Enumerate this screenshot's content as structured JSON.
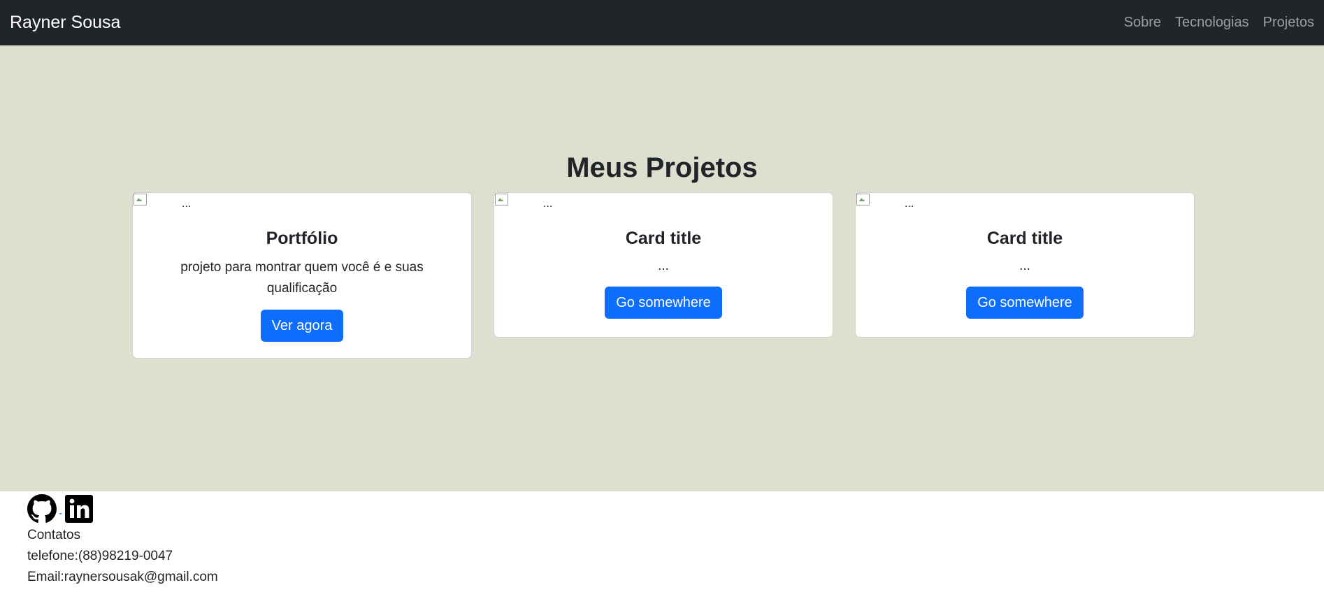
{
  "navbar": {
    "brand": "Rayner Sousa",
    "links": [
      "Sobre",
      "Tecnologias",
      "Projetos"
    ]
  },
  "projects": {
    "title": "Meus Projetos",
    "cards": [
      {
        "img_alt": "...",
        "title": "Portfólio",
        "text": "projeto para montrar quem você é e suas qualificação",
        "button": "Ver agora"
      },
      {
        "img_alt": "...",
        "title": "Card title",
        "text": "...",
        "button": "Go somewhere"
      },
      {
        "img_alt": "...",
        "title": "Card title",
        "text": "...",
        "button": "Go somewhere"
      }
    ]
  },
  "footer": {
    "social": {
      "separator": "-",
      "icons": [
        "github-icon",
        "linkedin-icon"
      ]
    },
    "contacts_label": "Contatos",
    "phone": "telefone:(88)98219-0047",
    "email": "Email:raynersousak@gmail.com"
  },
  "colors": {
    "navbar_bg": "#212529",
    "section_bg": "#dee0cf",
    "primary": "#0d6efd"
  }
}
